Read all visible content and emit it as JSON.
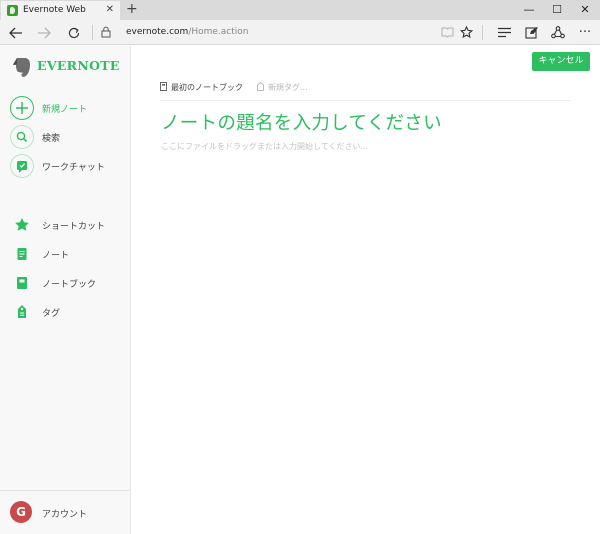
{
  "browser": {
    "tab_title": "Evernote Web",
    "tab_close": "✕",
    "new_tab": "+",
    "window_controls": [
      "—",
      "☐",
      "✕"
    ],
    "url_host": "evernote.com",
    "url_path": "/Home.action",
    "more": "···"
  },
  "sidebar": {
    "brand": "EVERNOTE",
    "items": [
      {
        "label": "新規ノート",
        "icon": "plus-icon"
      },
      {
        "label": "検索",
        "icon": "search-icon"
      },
      {
        "label": "ワークチャット",
        "icon": "chat-icon"
      },
      {
        "label": "ショートカット",
        "icon": "star-icon"
      },
      {
        "label": "ノート",
        "icon": "note-icon"
      },
      {
        "label": "ノートブック",
        "icon": "notebook-icon"
      },
      {
        "label": "タグ",
        "icon": "tag-icon"
      }
    ],
    "account": {
      "label": "アカウント",
      "avatar_letter": "G"
    }
  },
  "editor": {
    "cancel_label": "キャンセル",
    "notebook_label": "最初のノートブック",
    "tag_placeholder": "新規タグ...",
    "title_placeholder": "ノートの題名を入力してください",
    "body_placeholder": "ここにファイルをドラッグまたは入力開始してください..."
  },
  "colors": {
    "accent": "#2dbe60",
    "sidebar_bg": "#f8f8f8",
    "chrome_bg": "#f2f2f2"
  }
}
